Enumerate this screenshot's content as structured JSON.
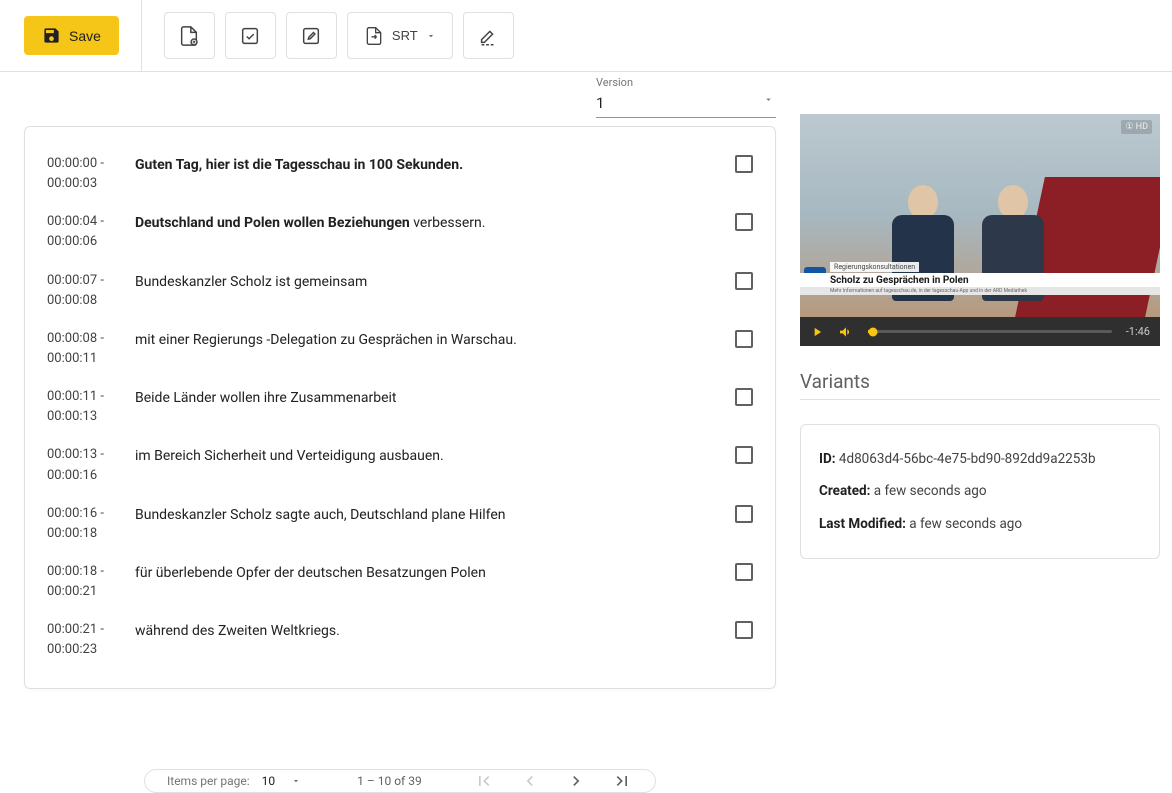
{
  "toolbar": {
    "save_label": "Save",
    "srt_label": "SRT"
  },
  "version": {
    "label": "Version",
    "value": "1"
  },
  "subtitles": [
    {
      "start": "00:00:00",
      "end": "00:00:03",
      "bold": "Guten Tag, hier ist die Tagesschau in 100 Sekunden.",
      "plain": ""
    },
    {
      "start": "00:00:04",
      "end": "00:00:06",
      "bold": "Deutschland und Polen wollen Beziehungen",
      "plain": " verbessern."
    },
    {
      "start": "00:00:07",
      "end": "00:00:08",
      "bold": "",
      "plain": "Bundeskanzler Scholz ist gemeinsam"
    },
    {
      "start": "00:00:08",
      "end": "00:00:11",
      "bold": "",
      "plain": "mit einer Regierungs -Delegation zu Gesprächen in Warschau."
    },
    {
      "start": "00:00:11",
      "end": "00:00:13",
      "bold": "",
      "plain": "Beide Länder wollen ihre Zusammenarbeit"
    },
    {
      "start": "00:00:13",
      "end": "00:00:16",
      "bold": "",
      "plain": "im Bereich Sicherheit und Verteidigung ausbauen."
    },
    {
      "start": "00:00:16",
      "end": "00:00:18",
      "bold": "",
      "plain": "Bundeskanzler Scholz sagte auch, Deutschland plane Hilfen"
    },
    {
      "start": "00:00:18",
      "end": "00:00:21",
      "bold": "",
      "plain": "für überlebende Opfer der deutschen Besatzungen Polen"
    },
    {
      "start": "00:00:21",
      "end": "00:00:23",
      "bold": "",
      "plain": "während des Zweiten Weltkriegs."
    }
  ],
  "pagination": {
    "items_per_page_label": "Items per page:",
    "items_per_page_value": "10",
    "range_text": "1 – 10 of 39"
  },
  "video": {
    "remaining": "-1:46",
    "lower_third_pretitle": "Regierungskonsultationen",
    "lower_third_title": "Scholz zu Gesprächen in Polen",
    "lower_third_footer": "Mehr Informationen auf tagesschau.de, in der tagesschau-App und in der ARD Mediathek",
    "channel_badge": "① HD"
  },
  "variants": {
    "heading": "Variants"
  },
  "meta": {
    "id_label": "ID:",
    "id_value": "4d8063d4-56bc-4e75-bd90-892dd9a2253b",
    "created_label": "Created:",
    "created_value": "a few seconds ago",
    "modified_label": "Last Modified:",
    "modified_value": "a few seconds ago"
  }
}
